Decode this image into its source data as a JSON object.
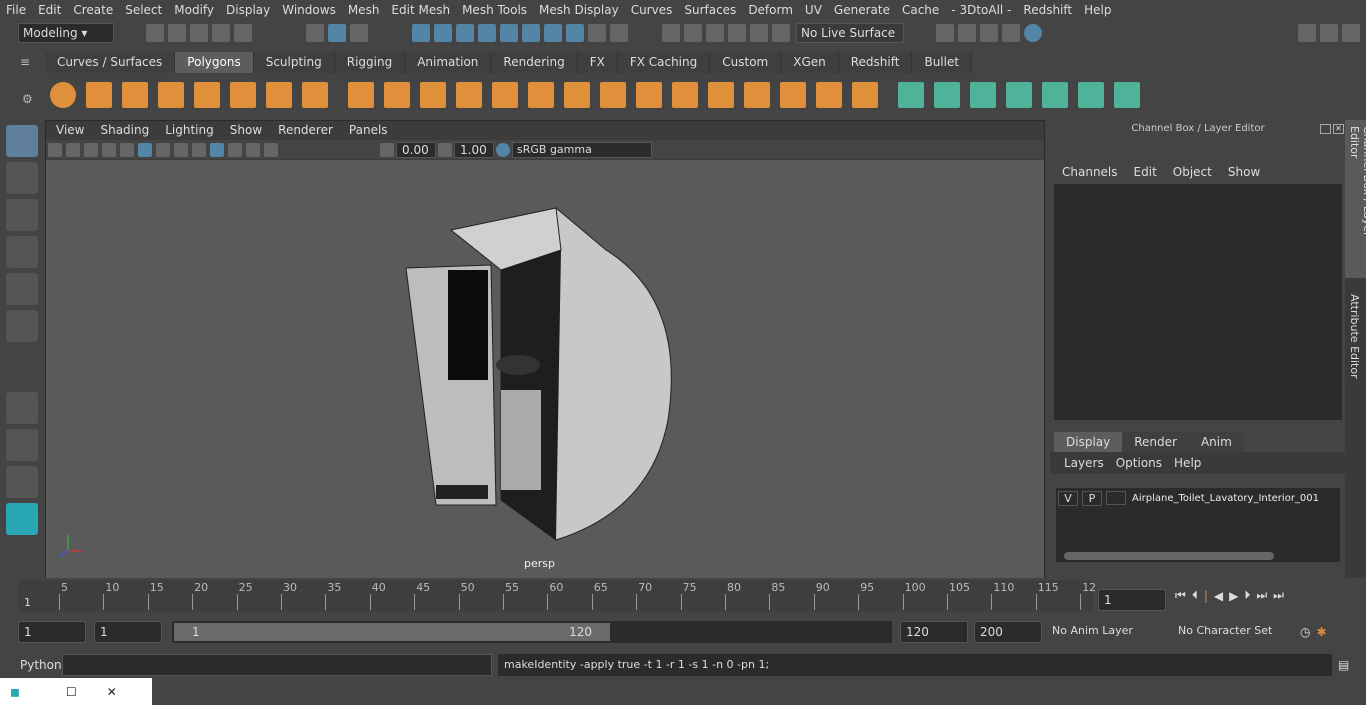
{
  "menubar": [
    "File",
    "Edit",
    "Create",
    "Select",
    "Modify",
    "Display",
    "Windows",
    "Mesh",
    "Edit Mesh",
    "Mesh Tools",
    "Mesh Display",
    "Curves",
    "Surfaces",
    "Deform",
    "UV",
    "Generate",
    "Cache",
    "- 3DtoAll -",
    "Redshift",
    "Help"
  ],
  "toolbar": {
    "mode": "Modeling",
    "live_surface": "No Live Surface"
  },
  "shelf_tabs": [
    "Curves / Surfaces",
    "Polygons",
    "Sculpting",
    "Rigging",
    "Animation",
    "Rendering",
    "FX",
    "FX Caching",
    "Custom",
    "XGen",
    "Redshift",
    "Bullet"
  ],
  "active_shelf_tab": "Polygons",
  "viewport": {
    "menus": [
      "View",
      "Shading",
      "Lighting",
      "Show",
      "Renderer",
      "Panels"
    ],
    "exposure": "0.00",
    "gamma": "1.00",
    "color_space": "sRGB gamma",
    "camera_label": "persp"
  },
  "channel_box": {
    "title": "Channel Box / Layer Editor",
    "menus": [
      "Channels",
      "Edit",
      "Object",
      "Show"
    ]
  },
  "layer_editor": {
    "tabs": [
      "Display",
      "Render",
      "Anim"
    ],
    "active_tab": "Display",
    "menus": [
      "Layers",
      "Options",
      "Help"
    ],
    "layer": {
      "v": "V",
      "p": "P",
      "name": "Airplane_Toilet_Lavatory_Interior_001"
    }
  },
  "side_tabs": [
    "Channel Box / Layer Editor",
    "Attribute Editor"
  ],
  "timeline": {
    "ticks": [
      "5",
      "10",
      "15",
      "20",
      "25",
      "30",
      "35",
      "40",
      "45",
      "50",
      "55",
      "60",
      "65",
      "70",
      "75",
      "80",
      "85",
      "90",
      "95",
      "100",
      "105",
      "110",
      "115",
      "12"
    ],
    "start_marker": "1",
    "current_frame": "1"
  },
  "range": {
    "start": "1",
    "playback_start": "1",
    "slider_start": "1",
    "slider_end": "120",
    "playback_end": "120",
    "end": "200",
    "anim_layer": "No Anim Layer",
    "character_set": "No Character Set"
  },
  "command": {
    "language": "Python",
    "output": "makeIdentity -apply true -t 1 -r 1 -s 1 -n 0 -pn 1;"
  }
}
